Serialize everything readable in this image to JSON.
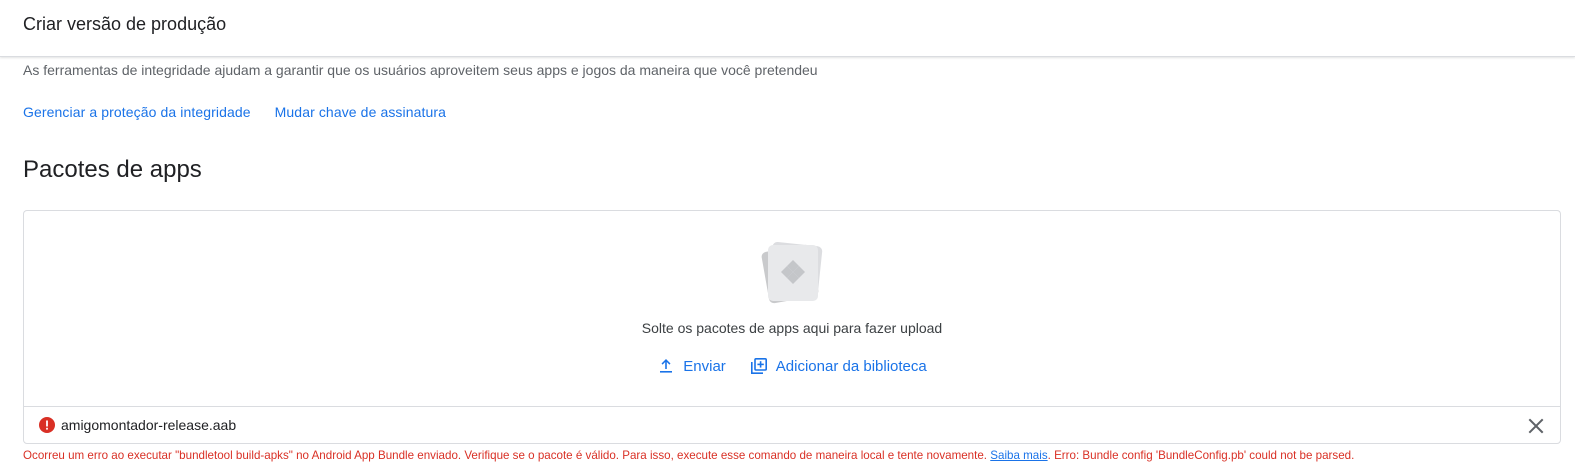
{
  "header": {
    "title": "Criar versão de produção"
  },
  "integrity": {
    "description": "As ferramentas de integridade ajudam a garantir que os usuários aproveitem seus apps e jogos da maneira que você pretendeu",
    "links": {
      "manage": "Gerenciar a proteção da integridade",
      "change_key": "Mudar chave de assinatura"
    }
  },
  "app_bundles": {
    "title": "Pacotes de apps",
    "dropzone": {
      "text": "Solte os pacotes de apps aqui para fazer upload",
      "upload_label": "Enviar",
      "library_label": "Adicionar da biblioteca"
    },
    "file": {
      "name": "amigomontador-release.aab",
      "status_icon": "error-icon"
    },
    "error": {
      "prefix": "Ocorreu um erro ao executar \"bundletool build-apks\" no Android App Bundle enviado. Verifique se o pacote é válido. Para isso, execute esse comando de maneira local e tente novamente.",
      "link": "Saiba mais",
      "suffix": ". Erro: Bundle config 'BundleConfig.pb' could not be parsed."
    }
  },
  "colors": {
    "link": "#1a73e8",
    "error": "#d93025",
    "border": "#dadce0"
  }
}
